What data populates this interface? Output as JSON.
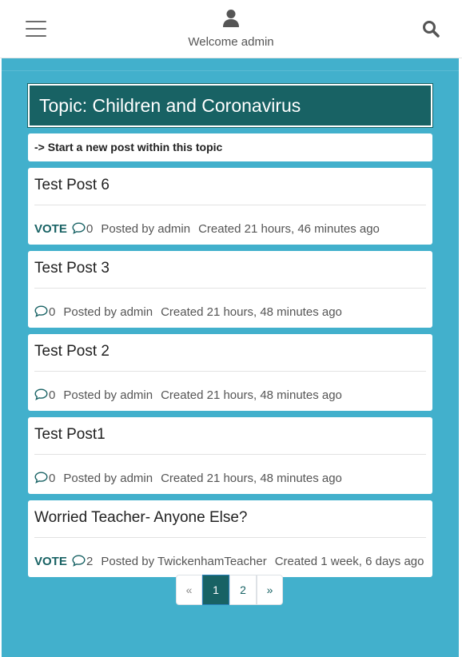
{
  "header": {
    "welcome": "Welcome admin",
    "menu_icon": "hamburger-icon",
    "user_icon": "user-icon",
    "search_icon": "search-icon"
  },
  "topic": {
    "title": "Topic: Children and Coronavirus",
    "new_post_link": "-> Start a new post within this topic"
  },
  "posts": [
    {
      "title": "Test Post 6",
      "vote": "VOTE",
      "comments": "0",
      "posted_by": "Posted by admin",
      "created": "Created 21 hours, 46 minutes ago"
    },
    {
      "title": "Test Post 3",
      "vote": "",
      "comments": "0",
      "posted_by": "Posted by admin",
      "created": "Created 21 hours, 48 minutes ago"
    },
    {
      "title": "Test Post 2",
      "vote": "",
      "comments": "0",
      "posted_by": "Posted by admin",
      "created": "Created 21 hours, 48 minutes ago"
    },
    {
      "title": "Test Post1",
      "vote": "",
      "comments": "0",
      "posted_by": "Posted by admin",
      "created": "Created 21 hours, 48 minutes ago"
    },
    {
      "title": "Worried Teacher- Anyone Else?",
      "vote": "VOTE",
      "comments": "2",
      "posted_by": "Posted by TwickenhamTeacher",
      "created": "Created 1 week, 6 days ago"
    }
  ],
  "pagination": {
    "prev": "«",
    "pages": [
      "1",
      "2"
    ],
    "active_page": "1",
    "next": "»"
  },
  "colors": {
    "accent": "#186264",
    "background": "#42b0cc"
  }
}
